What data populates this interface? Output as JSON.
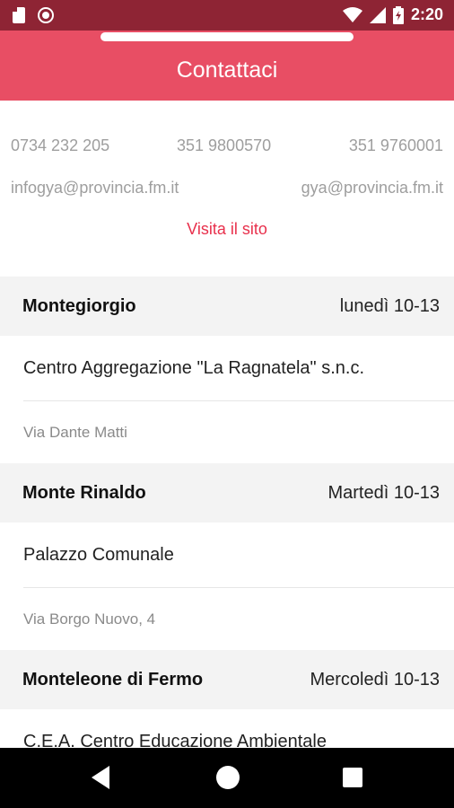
{
  "status_bar": {
    "time": "2:20",
    "icons": [
      "sd-card-icon",
      "record-icon",
      "wifi-icon",
      "signal-icon",
      "battery-icon"
    ]
  },
  "app_bar": {
    "title": "Contattaci"
  },
  "contacts": {
    "phones": [
      "0734 232 205",
      "351 9800570",
      "351 9760001"
    ],
    "emails": [
      "infogya@provincia.fm.it",
      "gya@provincia.fm.it"
    ],
    "website_link": "Visita il sito"
  },
  "locations": [
    {
      "town": "Montegiorgio",
      "hours": "lunedì 10-13",
      "place": "Centro Aggregazione \"La Ragnatela\" s.n.c.",
      "address": "Via Dante Matti"
    },
    {
      "town": "Monte Rinaldo",
      "hours": "Martedì 10-13",
      "place": "Palazzo Comunale",
      "address": "Via Borgo Nuovo, 4"
    },
    {
      "town": "Monteleone di Fermo",
      "hours": "Mercoledì 10-13",
      "place": "C.E.A. Centro Educazione Ambientale"
    }
  ],
  "colors": {
    "status_bar": "#8e2434",
    "app_bar": "#e84e64",
    "link": "#e8304c",
    "section_bg": "#f3f3f3"
  }
}
